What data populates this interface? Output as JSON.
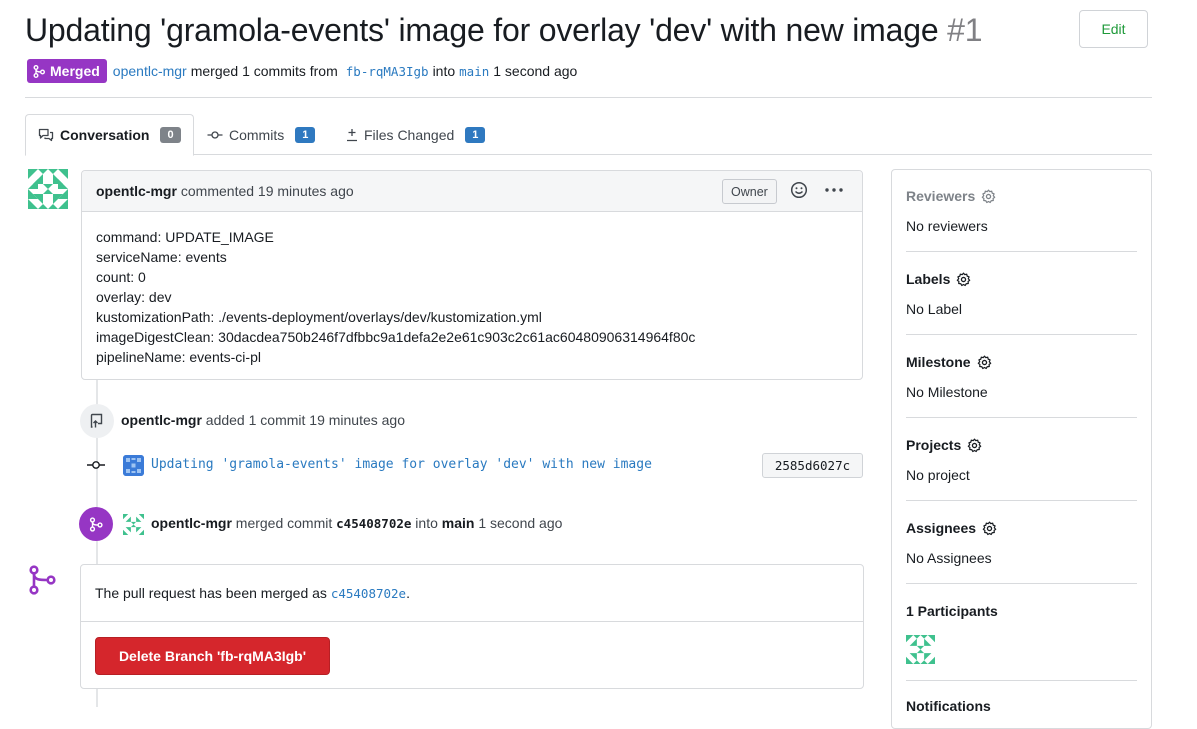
{
  "pr": {
    "title": "Updating 'gramola-events' image for overlay 'dev' with new image",
    "number": "#1",
    "edit_label": "Edit",
    "status_label": "Merged",
    "meta": {
      "author": "opentlc-mgr",
      "merged_text": "merged 1 commits from",
      "source_branch": "fb-rqMA3Igb",
      "into_text": "into",
      "target_branch": "main",
      "time": "1 second ago"
    }
  },
  "tabs": [
    {
      "label": "Conversation",
      "count": "0"
    },
    {
      "label": "Commits",
      "count": "1"
    },
    {
      "label": "Files Changed",
      "count": "1"
    }
  ],
  "comment": {
    "author": "opentlc-mgr",
    "action": "commented 19 minutes ago",
    "role_badge": "Owner",
    "lines": [
      "command: UPDATE_IMAGE",
      "serviceName: events",
      "count: 0",
      "overlay: dev",
      "kustomizationPath: ./events-deployment/overlays/dev/kustomization.yml",
      "imageDigestClean: 30dacdea750b246f7dfbbc9a1defa2e2e61c903c2c61ac60480906314964f80c",
      "pipelineName: events-ci-pl"
    ]
  },
  "commit_event": {
    "author": "opentlc-mgr",
    "action": "added 1 commit 19 minutes ago",
    "commit_message": "Updating 'gramola-events' image for overlay 'dev' with new image",
    "sha": "2585d6027c"
  },
  "merge_event": {
    "author": "opentlc-mgr",
    "action": "merged commit",
    "commit_sha": "c45408702e",
    "into_text": "into",
    "target_branch": "main",
    "time": "1 second ago"
  },
  "merge_box": {
    "message_prefix": "The pull request has been merged as",
    "commit_sha": "c45408702e",
    "message_suffix": ".",
    "delete_button_label": "Delete Branch 'fb-rqMA3Igb'"
  },
  "sidebar": {
    "reviewers": {
      "title": "Reviewers",
      "value": "No reviewers"
    },
    "labels": {
      "title": "Labels",
      "value": "No Label"
    },
    "milestone": {
      "title": "Milestone",
      "value": "No Milestone"
    },
    "projects": {
      "title": "Projects",
      "value": "No project"
    },
    "assignees": {
      "title": "Assignees",
      "value": "No Assignees"
    },
    "participants": {
      "title": "1 Participants"
    },
    "notifications": {
      "title": "Notifications"
    }
  },
  "colors": {
    "merged_purple": "#9636c4",
    "link_blue": "#2a7ac0",
    "delete_red": "#d5262c",
    "avatar_green": "#3fc18e"
  }
}
